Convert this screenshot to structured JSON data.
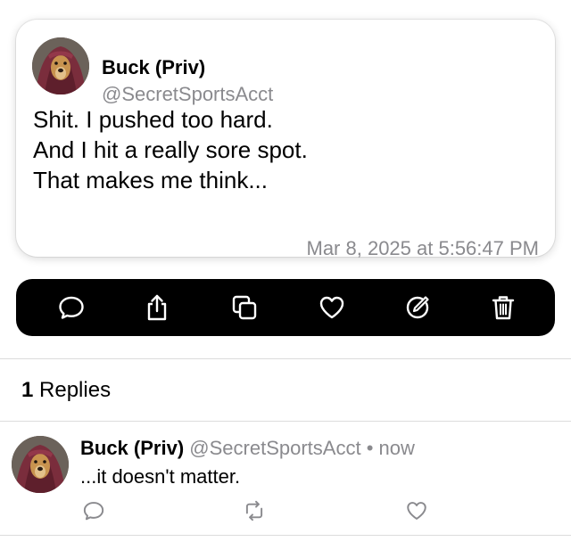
{
  "post": {
    "author_name": "Buck (Priv)",
    "author_handle": "@SecretSportsAcct",
    "body_lines": [
      "Shit. I pushed too hard.",
      "And I hit a really sore spot.",
      "That makes me think..."
    ],
    "timestamp": "Mar 8, 2025 at 5:56:47 PM"
  },
  "action_bar": {
    "icons": [
      "reply-icon",
      "share-icon",
      "copy-icon",
      "like-icon",
      "edit-icon",
      "delete-icon"
    ],
    "background": "#000000",
    "icon_color": "#ffffff"
  },
  "replies": {
    "count": "1",
    "label": "Replies",
    "items": [
      {
        "author_name": "Buck (Priv)",
        "author_handle": "@SecretSportsAcct",
        "separator": "•",
        "time": "now",
        "text": "...it doesn't matter.",
        "actions": [
          "reply-icon",
          "repost-icon",
          "like-icon"
        ]
      }
    ]
  },
  "colors": {
    "secondary_text": "#8a8a8e",
    "reply_icon_color": "#8a8a8e"
  }
}
